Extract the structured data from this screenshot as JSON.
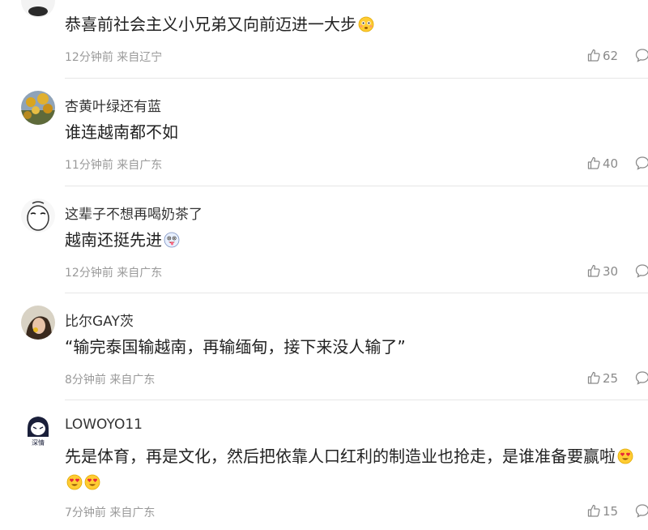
{
  "comments": [
    {
      "username": "",
      "content": "恭喜前社会主义小兄弟又向前迈进一大步",
      "emoji": "flushed-face",
      "time": "12分钟前",
      "location": "来自辽宁",
      "likes": "62"
    },
    {
      "username": "杏黄叶绿还有蓝",
      "content": "谁连越南都不如",
      "emoji": "",
      "time": "11分钟前",
      "location": "来自广东",
      "likes": "40"
    },
    {
      "username": "这辈子不想再喝奶茶了",
      "content": "越南还挺先进",
      "emoji": "silly-face",
      "time": "12分钟前",
      "location": "来自广东",
      "likes": "30"
    },
    {
      "username": "比尔GAY茨",
      "content": "“输完泰国输越南，再输缅甸，接下来没人输了”",
      "emoji": "",
      "time": "8分钟前",
      "location": "来自广东",
      "likes": "25"
    },
    {
      "username": "LOWOYO11",
      "content": "先是体育，再是文化，然后把依靠人口红利的制造业也抢走，是谁准备要赢啦",
      "emoji": "heart-eyes-face",
      "time": "7分钟前",
      "location": "来自广东",
      "likes": "15",
      "avatar_text": "深情"
    }
  ],
  "icons": {
    "like": "thumbs-up-icon",
    "reply": "comment-bubble-icon"
  }
}
